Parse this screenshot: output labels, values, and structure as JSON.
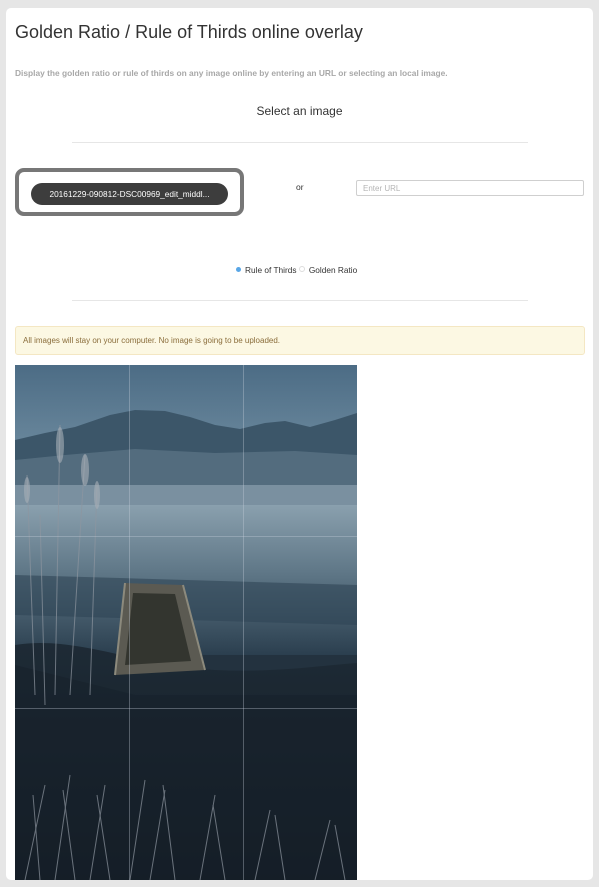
{
  "page": {
    "title": "Golden Ratio / Rule of Thirds online overlay",
    "subtitle": "Display the golden ratio or rule of thirds on any image online by entering an URL or selecting an local image.",
    "section_heading": "Select an image"
  },
  "file_picker": {
    "label": "20161229-090812-DSC00969_edit_middl..."
  },
  "or_label": "or",
  "url_field": {
    "value": "",
    "placeholder": "Enter URL"
  },
  "overlay_options": [
    {
      "label": "Rule of Thirds",
      "selected": true
    },
    {
      "label": "Golden Ratio",
      "selected": false
    }
  ],
  "notice": "All images will stay on your computer. No image is going to be uploaded.",
  "overlay": {
    "type": "Rule of Thirds",
    "grid_color": "#c8d2dc"
  },
  "colors": {
    "alert_bg": "#fcf8e3",
    "alert_text": "#8a6d3b",
    "radio_selected": "#58a6e6",
    "button_bg": "#3d3d3d"
  }
}
